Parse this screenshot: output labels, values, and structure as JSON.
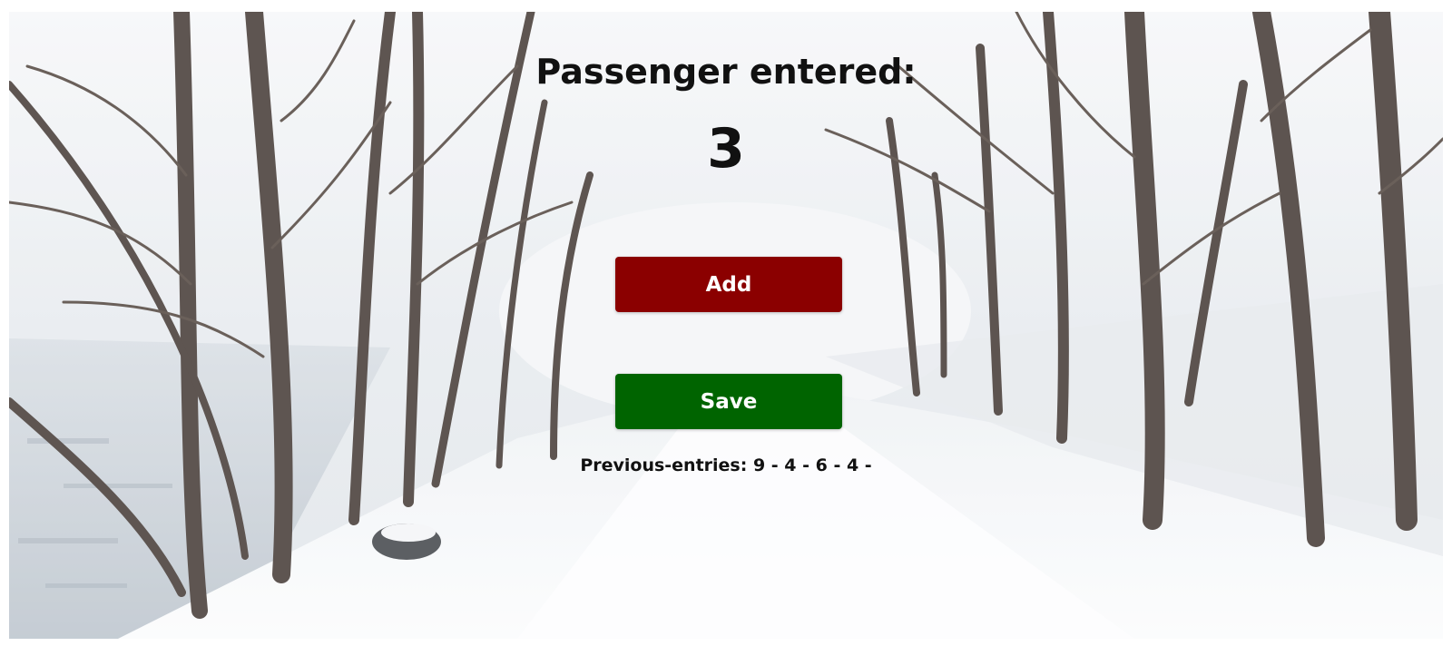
{
  "counter": {
    "title": "Passenger entered:",
    "count": "3"
  },
  "buttons": {
    "add_label": "Add",
    "save_label": "Save"
  },
  "history": {
    "label": "Previous-entries: 9 - 4 - 6 - 4 -"
  },
  "background": {
    "image": "snowy-forest-path"
  },
  "colors": {
    "add_button": "#8b0000",
    "save_button": "#006400",
    "text": "#111111"
  }
}
